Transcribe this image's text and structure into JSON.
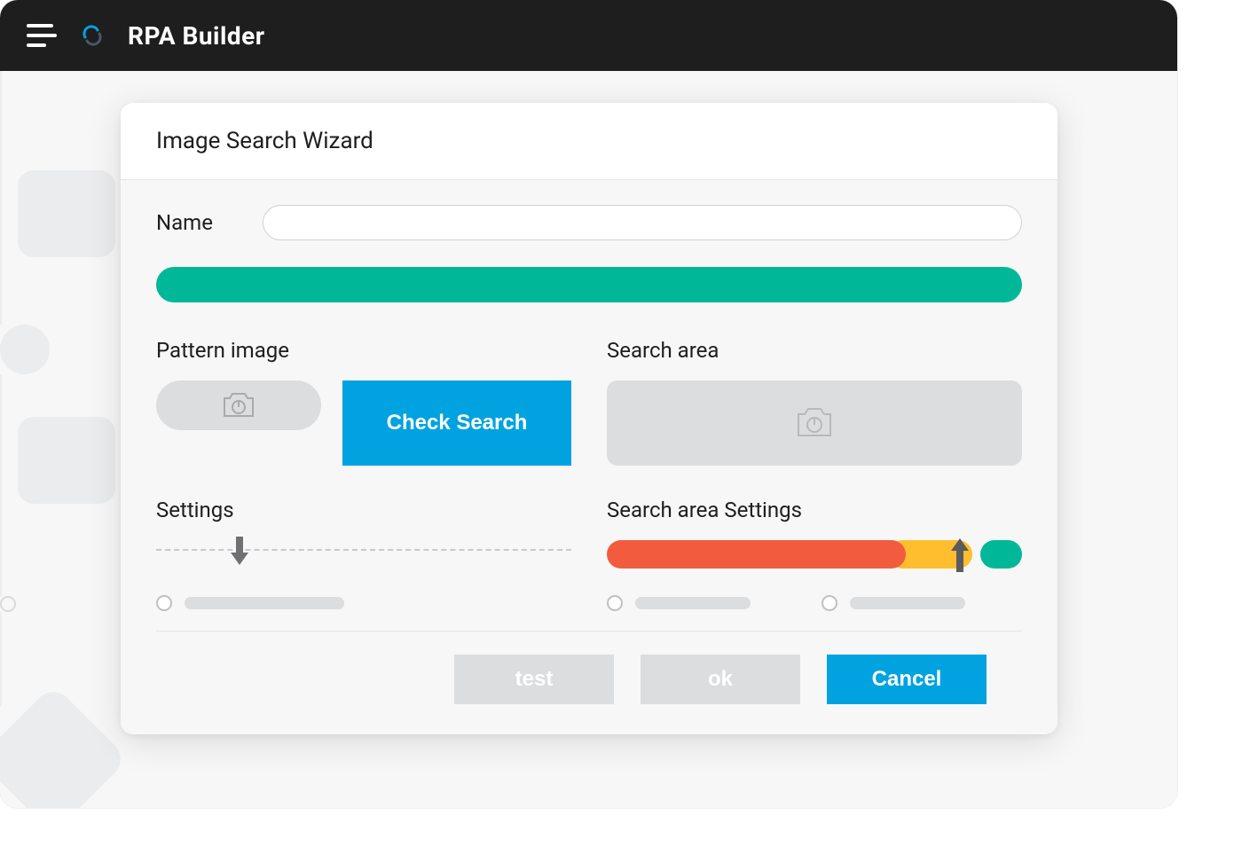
{
  "app_title": "RPA Builder",
  "modal": {
    "title": "Image Search Wizard",
    "name_label": "Name",
    "name_value": "",
    "pattern_image_label": "Pattern image",
    "check_search_label": "Check Search",
    "search_area_label": "Search area",
    "settings_label": "Settings",
    "search_area_settings_label": "Search area Settings",
    "footer": {
      "test": "test",
      "ok": "ok",
      "cancel": "Cancel"
    }
  },
  "colors": {
    "teal": "#00b897",
    "blue": "#00a3e0",
    "orange": "#f35b3f",
    "yellow": "#ffbe2e",
    "dark": "#1e1e1e"
  },
  "slider": {
    "settings_position_pct": 18,
    "search_area_position_pct": 83
  }
}
